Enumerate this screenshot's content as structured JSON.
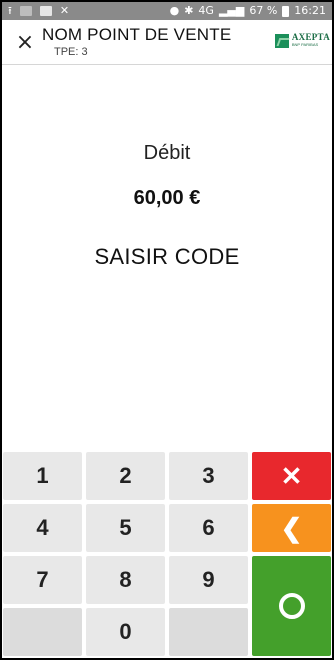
{
  "status_bar": {
    "signal_text": "4G",
    "battery_percent": "67 %",
    "time": "16:21",
    "icons": [
      "upload-icon",
      "image-icon",
      "image-icon",
      "close-icon",
      "record-icon",
      "bluetooth-icon",
      "signal-icon",
      "battery-icon"
    ]
  },
  "header": {
    "title": "NOM POINT DE VENTE",
    "tpe_label": "TPE:",
    "tpe_value": "3",
    "logo_name": "AXEPTA",
    "logo_sub": "BNP PARIBAS"
  },
  "transaction": {
    "type": "Débit",
    "amount": "60,00 €",
    "prompt": "SAISIR CODE"
  },
  "keypad": {
    "keys": [
      "1",
      "2",
      "3",
      "4",
      "5",
      "6",
      "7",
      "8",
      "9",
      "0"
    ],
    "cancel_symbol": "✕",
    "back_symbol": "❮",
    "colors": {
      "cancel": "#e8282d",
      "back": "#f7921e",
      "ok": "#44a02b",
      "key": "#e8e8e8"
    }
  }
}
